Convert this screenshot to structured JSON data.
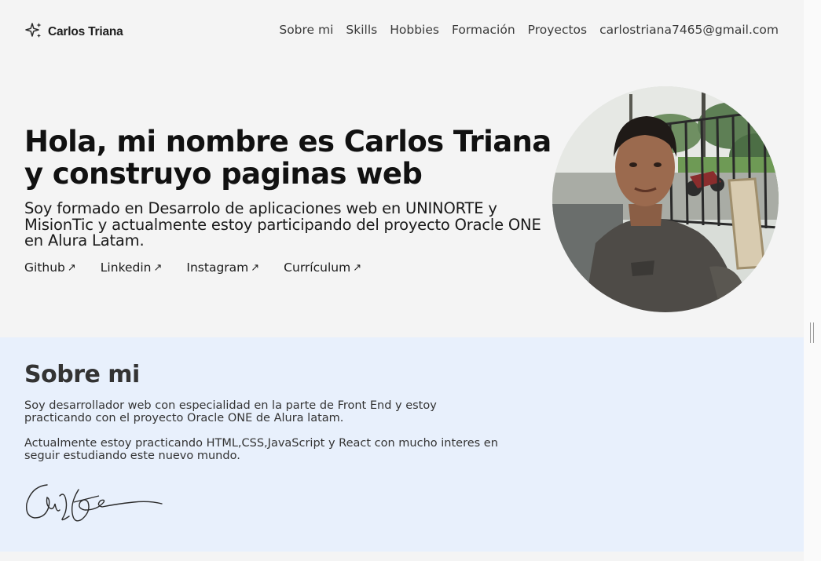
{
  "header": {
    "brand": "Carlos Triana",
    "brand_icon": "sparkles-icon",
    "nav": [
      {
        "label": "Sobre mi"
      },
      {
        "label": "Skills"
      },
      {
        "label": "Hobbies"
      },
      {
        "label": "Formación"
      },
      {
        "label": "Proyectos"
      },
      {
        "label": "carlostriana7465@gmail.com"
      }
    ]
  },
  "hero": {
    "title": "Hola, mi nombre es Carlos Triana y construyo paginas web",
    "subtitle": "Soy formado en Desarrolo de aplicaciones web en UNINORTE y MisionTic y actualmente estoy participando del proyecto Oracle ONE en Alura Latam.",
    "links": [
      {
        "label": "Github",
        "icon": "arrow-up-right-icon"
      },
      {
        "label": "Linkedin",
        "icon": "arrow-up-right-icon"
      },
      {
        "label": "Instagram",
        "icon": "arrow-up-right-icon"
      },
      {
        "label": "Currículum",
        "icon": "arrow-up-right-icon"
      }
    ],
    "arrow_glyph": "↗"
  },
  "about": {
    "title": "Sobre mi",
    "paragraph_1": "Soy desarrollador web con especialidad en la parte de Front End y estoy practicando con el proyecto Oracle ONE de Alura latam.",
    "paragraph_2": "Actualmente estoy practicando HTML,CSS,JavaScript y React con mucho interes en seguir estudiando este nuevo mundo."
  },
  "colors": {
    "background": "#f4f4f4",
    "about_background": "#e8f0fc",
    "text": "#1a1a1a"
  }
}
